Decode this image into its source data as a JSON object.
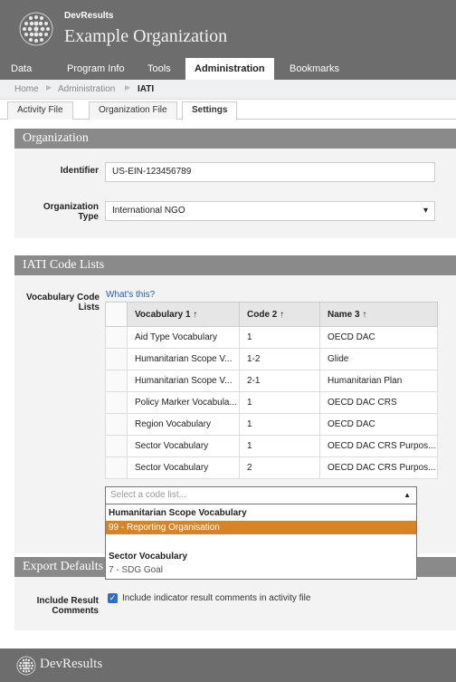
{
  "header": {
    "app_name": "DevResults",
    "org_name": "Example Organization"
  },
  "nav": {
    "items": [
      "Data",
      "Program Info",
      "Tools",
      "Administration",
      "Bookmarks"
    ],
    "active": "Administration"
  },
  "breadcrumb": [
    "Home",
    "Administration",
    "IATI"
  ],
  "tabs": [
    "Activity File",
    "Organization File",
    "Settings"
  ],
  "active_tab": "Settings",
  "organization": {
    "title": "Organization",
    "identifier_label": "Identifier",
    "identifier_value": "US-EIN-123456789",
    "type_label_1": "Organization",
    "type_label_2": "Type",
    "type_value": "International NGO"
  },
  "code_lists": {
    "title": "IATI Code Lists",
    "label_1": "Vocabulary Code",
    "label_2": "Lists",
    "help_link": "What's this?",
    "columns": [
      "Vocabulary 1 ↑",
      "Code 2 ↑",
      "Name 3 ↑"
    ],
    "rows": [
      [
        "Aid Type Vocabulary",
        "1",
        "OECD DAC"
      ],
      [
        "Humanitarian Scope V...",
        "1-2",
        "Glide"
      ],
      [
        "Humanitarian Scope V...",
        "2-1",
        "Humanitarian Plan"
      ],
      [
        "Policy Marker Vocabula...",
        "1",
        "OECD DAC CRS"
      ],
      [
        "Region Vocabulary",
        "1",
        "OECD DAC"
      ],
      [
        "Sector Vocabulary",
        "1",
        "OECD DAC CRS Purpos..."
      ],
      [
        "Sector Vocabulary",
        "2",
        "OECD DAC CRS Purpos..."
      ]
    ],
    "select_placeholder": "Select a code list...",
    "dropdown": {
      "group_1": "Humanitarian Scope Vocabulary",
      "group_1_option": "99 - Reporting Organisation",
      "group_2": "Sector Vocabulary",
      "group_2_option": "7 - SDG Goal"
    }
  },
  "export": {
    "title": "Export Defaults",
    "label_1": "Include Result",
    "label_2": "Comments",
    "checkbox_text": "Include indicator result comments in activity file",
    "checked": true
  },
  "footer": {
    "brand": "DevResults"
  },
  "colors": {
    "header_bg": "#6d6d6d",
    "section_bar": "#8a8a8a",
    "highlight": "#d4842b",
    "link": "#2a5db0",
    "checkbox": "#2f6dc9"
  }
}
